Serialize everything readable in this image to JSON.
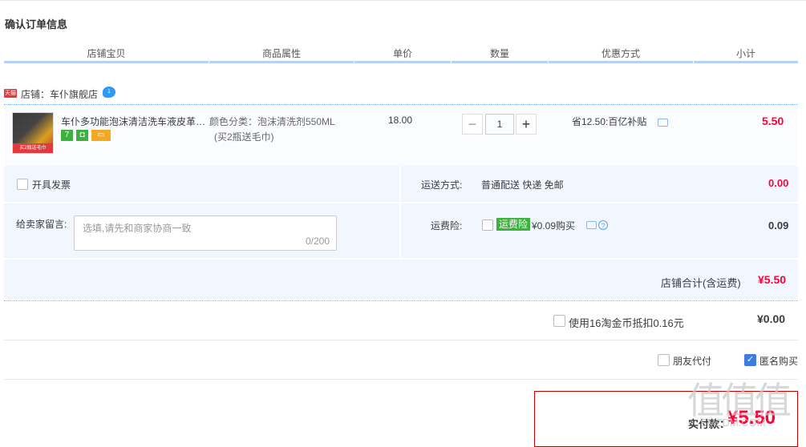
{
  "page": {
    "section_title": "确认订单信息"
  },
  "columns": [
    "店铺宝贝",
    "商品属性",
    "单价",
    "数量",
    "优惠方式",
    "小计"
  ],
  "shop": {
    "icon_text": "天猫",
    "label": "店铺：车仆旗舰店",
    "chat_badge": "1"
  },
  "item": {
    "thumb_badge": "买2瓶送毛巾",
    "title": "车仆多功能泡沫清洁洗车液皮革内饰清洗剂",
    "tags": [
      {
        "text": "7",
        "color": "#3cb23c"
      },
      {
        "text": "◘",
        "color": "#3cb23c"
      },
      {
        "text": "▭",
        "color": "#f5a623"
      }
    ],
    "prop_line1": "颜色分类：泡沫清洗剂550ML",
    "prop_line2": "(买2瓶送毛巾)",
    "unit_price": "18.00",
    "quantity": "1",
    "minus_label": "−",
    "plus_label": "+",
    "discount": "省12.50:百亿补贴",
    "subtotal": "5.50"
  },
  "invoice": {
    "label": "开具发票"
  },
  "shipping": {
    "label": "运送方式:",
    "value": "普通配送 快递 免邮",
    "amount": "0.00"
  },
  "message": {
    "label": "给卖家留言:",
    "placeholder": "选填,请先和商家协商一致",
    "counter": "0/200"
  },
  "insurance": {
    "label": "运费险:",
    "badge": "运费险",
    "value": "¥0.09购买",
    "help": "?",
    "amount": "0.09"
  },
  "shop_total": {
    "label": "店铺合计(含运费)",
    "value": "¥5.50"
  },
  "coins": {
    "label": "使用16淘金币抵扣0.16元",
    "value": "¥0.00"
  },
  "options": {
    "friend_pay": "朋友代付",
    "anonymous": "匿名购买"
  },
  "final": {
    "label": "实付款：",
    "value": "¥5.50"
  },
  "watermark": {
    "big": "值值值",
    "small": "SMZDM.COM"
  },
  "colors": {
    "accent": "#ff0036",
    "blue_rule": "#b2d1ff",
    "panel": "#f2f7ff"
  }
}
